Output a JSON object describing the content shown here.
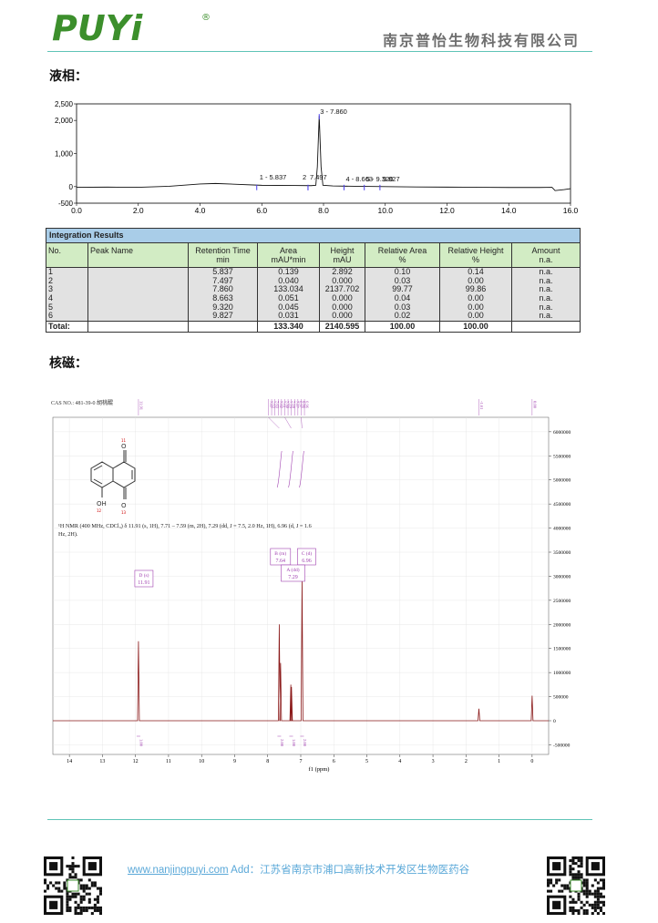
{
  "header": {
    "logo_text": "PUYi",
    "logo_mark": "®",
    "company_name": "南京普怡生物科技有限公司",
    "colors": {
      "brand_green": "#3c8f2c",
      "teal_rule": "#5fc4b7"
    }
  },
  "hplc": {
    "section_title": "液相：",
    "chart_data": {
      "type": "line",
      "x_ticks": [
        "0.0",
        "2.0",
        "4.0",
        "6.0",
        "8.0",
        "10.0",
        "12.0",
        "14.0",
        "16.0"
      ],
      "y_ticks": [
        "2,500",
        "2,000",
        "1,000",
        "0",
        "-500"
      ],
      "xlim": [
        0,
        16
      ],
      "ylim": [
        -500,
        2500
      ],
      "peaks": [
        {
          "label": "1 - 5.837",
          "x": 5.837,
          "y": 2.892
        },
        {
          "label": "2",
          "x": 7.497,
          "y": 0
        },
        {
          "label": "7.497",
          "x": 7.497,
          "y": 0
        },
        {
          "label": "3 - 7.860",
          "x": 7.86,
          "y": 2137.702
        },
        {
          "label": "4 - 8.663",
          "x": 8.663,
          "y": 0
        },
        {
          "label": "5 - 9.320",
          "x": 9.32,
          "y": 0
        },
        {
          "label": "9.827",
          "x": 9.827,
          "y": 0
        }
      ],
      "baseline": [
        [
          0,
          -20
        ],
        [
          1,
          -15
        ],
        [
          2,
          -20
        ],
        [
          3,
          10
        ],
        [
          4,
          80
        ],
        [
          4.5,
          95
        ],
        [
          5.2,
          70
        ],
        [
          6,
          40
        ],
        [
          7,
          35
        ],
        [
          7.6,
          30
        ],
        [
          7.75,
          40
        ],
        [
          7.8,
          600
        ],
        [
          7.86,
          2137
        ],
        [
          7.92,
          600
        ],
        [
          7.98,
          40
        ],
        [
          8.3,
          20
        ],
        [
          9,
          10
        ],
        [
          10,
          0
        ],
        [
          11,
          -10
        ],
        [
          12,
          -15
        ],
        [
          13,
          -20
        ],
        [
          14,
          -25
        ],
        [
          15,
          -25
        ],
        [
          15.4,
          -20
        ],
        [
          15.5,
          -120
        ],
        [
          15.8,
          -90
        ],
        [
          16,
          -60
        ]
      ],
      "colors": {
        "trace": "#111111",
        "marker": "#4b3ff0",
        "frame": "#000000"
      }
    },
    "integration": {
      "title": "Integration Results",
      "headers": [
        [
          "No.",
          ""
        ],
        [
          "Peak Name",
          ""
        ],
        [
          "Retention Time",
          "min"
        ],
        [
          "Area",
          "mAU*min"
        ],
        [
          "Height",
          "mAU"
        ],
        [
          "Relative Area",
          "%"
        ],
        [
          "Relative Height",
          "%"
        ],
        [
          "Amount",
          "n.a."
        ]
      ],
      "rows": [
        [
          "1",
          "",
          "5.837",
          "0.139",
          "2.892",
          "0.10",
          "0.14",
          "n.a."
        ],
        [
          "2",
          "",
          "7.497",
          "0.040",
          "0.000",
          "0.03",
          "0.00",
          "n.a."
        ],
        [
          "3",
          "",
          "7.860",
          "133.034",
          "2137.702",
          "99.77",
          "99.86",
          "n.a."
        ],
        [
          "4",
          "",
          "8.663",
          "0.051",
          "0.000",
          "0.04",
          "0.00",
          "n.a."
        ],
        [
          "5",
          "",
          "9.320",
          "0.045",
          "0.000",
          "0.03",
          "0.00",
          "n.a."
        ],
        [
          "6",
          "",
          "9.827",
          "0.031",
          "0.000",
          "0.02",
          "0.00",
          "n.a."
        ]
      ],
      "total": [
        "Total:",
        "",
        "",
        "133.340",
        "2140.595",
        "100.00",
        "100.00",
        ""
      ]
    }
  },
  "nmr": {
    "section_title": "核磁：",
    "cas_label": "CAS NO.: 481-39-0 胡桃醌",
    "structure_labels": {
      "oh": "OH",
      "o_top": "O",
      "o_bottom": "O",
      "n11": "11",
      "n12": "12",
      "n13": "13"
    },
    "description": "¹H NMR (400 MHz, CDCl₃) δ 11.91 (s, 1H), 7.71 – 7.59 (m, 2H), 7.29 (dd, J = 7.5, 2.0 Hz, 1H), 6.96 (d, J = 1.6 Hz, 2H).",
    "top_shift_labels": [
      "11.91",
      "7.67",
      "7.65",
      "7.63",
      "7.62",
      "7.61",
      "7.30",
      "7.29",
      "7.28",
      "7.27",
      "6.97",
      "6.96",
      "6.96",
      "-1.61",
      "0.00"
    ],
    "boxes": [
      {
        "line1": "D (s)",
        "line2": "11.91"
      },
      {
        "line1": "B (m)",
        "line2": "7.64"
      },
      {
        "line1": "C (d)",
        "line2": "6.96"
      },
      {
        "line1": "A (dd)",
        "line2": "7.29"
      }
    ],
    "integrals": [
      "1.00",
      "2.00",
      "1.00",
      "2.00"
    ],
    "chart_data": {
      "type": "line",
      "x_ticks": [
        "14",
        "13",
        "12",
        "11",
        "10",
        "9",
        "8",
        "7",
        "6",
        "5",
        "4",
        "3",
        "2",
        "1",
        "0"
      ],
      "y_ticks": [
        "6000000",
        "5500000",
        "5000000",
        "4500000",
        "4000000",
        "3500000",
        "3000000",
        "2500000",
        "2000000",
        "1500000",
        "1000000",
        "500000",
        "0",
        "-500000"
      ],
      "xlabel": "f1 (ppm)",
      "xlim": [
        14.5,
        -0.5
      ],
      "ylim": [
        -700000,
        6300000
      ],
      "peaks": [
        {
          "ppm": 11.91,
          "height": 1650000
        },
        {
          "ppm": 7.65,
          "height": 2000000
        },
        {
          "ppm": 7.61,
          "height": 1200000
        },
        {
          "ppm": 7.3,
          "height": 750000
        },
        {
          "ppm": 7.28,
          "height": 700000
        },
        {
          "ppm": 6.96,
          "height": 2900000
        },
        {
          "ppm": 1.61,
          "height": 250000
        },
        {
          "ppm": 0.0,
          "height": 520000
        }
      ],
      "colors": {
        "trace": "#8b1a1a",
        "annotation": "#a040b0"
      }
    }
  },
  "footer": {
    "website": "www.nanjingpuyi.com",
    "address_label": "Add：",
    "address": "江苏省南京市浦口高新技术开发区生物医药谷"
  }
}
